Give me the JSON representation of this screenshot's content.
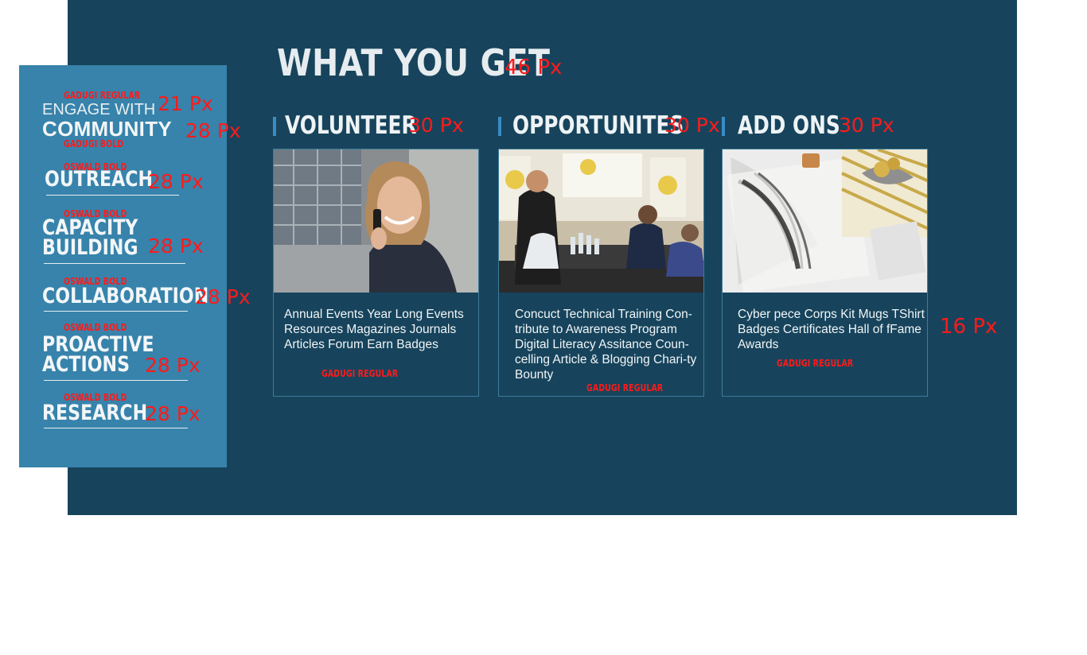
{
  "headline": "WHAT YOU GET",
  "headline_size": "46 Px",
  "sidebar": {
    "engage_top": "ENGAGE WITH",
    "engage_main": "COMMUNITY",
    "engage_font_note": "GADUGI REGULAR",
    "engage_top_size": "21 Px",
    "engage_main_size": "28 Px",
    "engage_bold_note": "GADUGI BOLD",
    "items": [
      {
        "label": "OUTREACH",
        "font_note": "OSWALD BOLD",
        "size": "28 Px"
      },
      {
        "label": "CAPACITY\nBUILDING",
        "font_note": "OSWALD BOLD",
        "size": "28 Px"
      },
      {
        "label": "COLLABORATION",
        "font_note": "OSWALD BOLD",
        "size": "28 Px"
      },
      {
        "label": "PROACTIVE\nACTIONS",
        "font_note": "OSWALD BOLD",
        "size": "28 Px"
      },
      {
        "label": "RESEARCH",
        "font_note": "OSWALD BOLD",
        "size": "28 Px"
      }
    ]
  },
  "columns": [
    {
      "title": "VOLUNTEER",
      "size": "30 Px",
      "text": "Annual Events  Year Long Events Resources Magazines  Journals Articles Forum  Earn Badges",
      "font_note": "GADUGI REGULAR",
      "image": "woman-on-phone-photo"
    },
    {
      "title": "OPPORTUNITES",
      "size": "30 Px",
      "text": "Concuct Technical Training  Con-tribute to Awareness Program Digital Literacy Assitance  Coun-celling  Article & Blogging Chari-ty Bounty",
      "font_note": "GADUGI REGULAR",
      "image": "training-session-photo"
    },
    {
      "title": "ADD ONS",
      "size": "30 Px",
      "text": "Cyber pece Corps Kit  Mugs TShirt Badges Certificates Hall of fFame  Awards",
      "font_note": "GADUGI REGULAR",
      "image": "gift-box-notebook-photo"
    }
  ],
  "body_text_size": "16 Px",
  "colors": {
    "main_bg": "#17445c",
    "sidebar_bg": "#3783ab",
    "annotation": "#ff1a1a",
    "accent_bar": "#3a8cc4"
  }
}
